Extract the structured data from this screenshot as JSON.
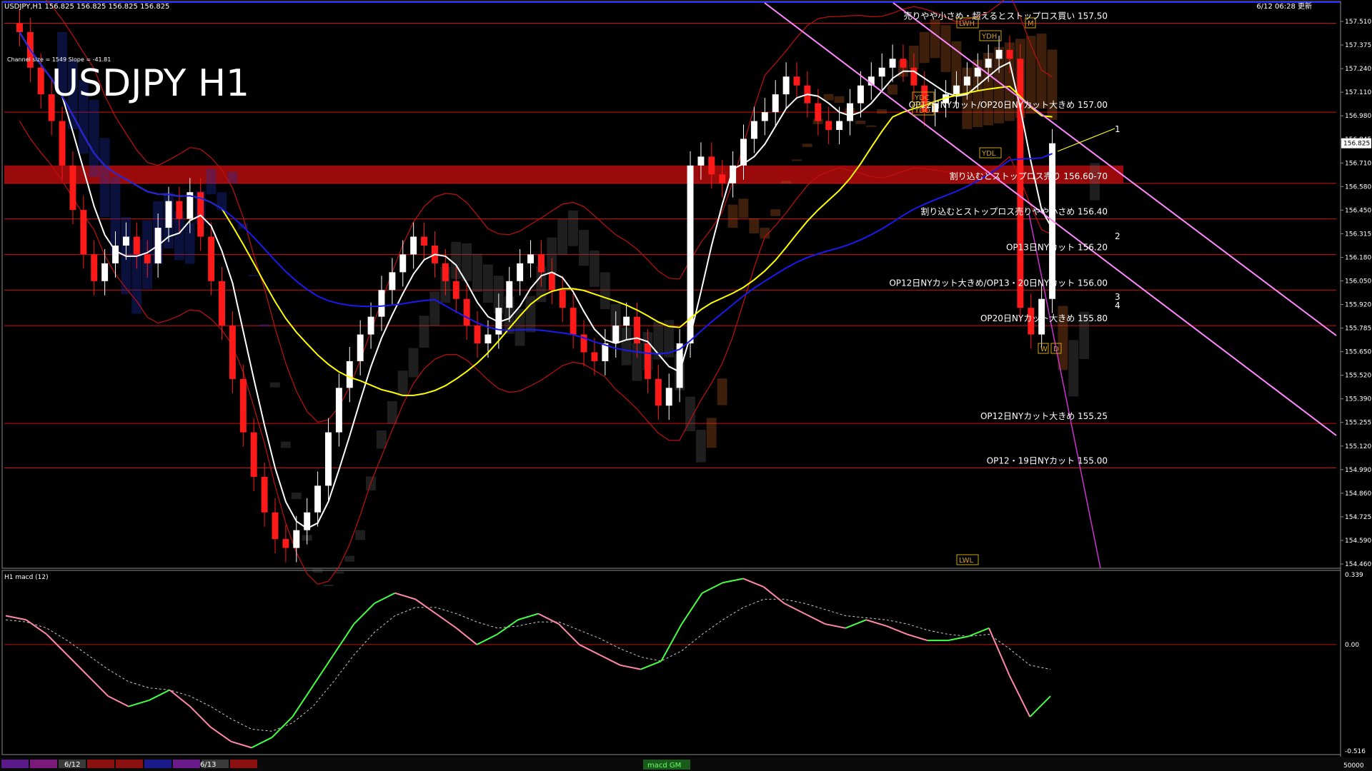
{
  "window": {
    "info_line": "USDJPY,H1  156.825 156.825 156.825 156.825",
    "datetime_label": "6/12 06:28 更新",
    "big_title": "USDJPY H1",
    "channel_info": "Channel size = 1549 Slope = -41.81",
    "subwindow_label": "H1  macd (12)"
  },
  "bottom_bar": {
    "date_labels": [
      "6/12",
      "6/13"
    ],
    "indicator_tag": "macd GM",
    "volume_label": "50000",
    "swatch_colors": [
      "#5a1a8a",
      "#7a1a7a",
      "#3a3a3a",
      "#8a1010",
      "#8a1010",
      "#1a1a8a",
      "#6a1a8a",
      "#3a3a3a",
      "#8a1010"
    ]
  },
  "colors": {
    "background": "#000000",
    "grid_text": "#ffffff",
    "bull_candle": "#ffffff",
    "bear_candle": "#ff1a1a",
    "level_line": "#d01010",
    "zone_fill": "#9a0a0a",
    "ma_fast": "#ffffff",
    "ma_mid": "#ffff00",
    "ma_slow": "#1a1aee",
    "channel_line": "#ff88ff",
    "macd_line_up": "#44ff44",
    "macd_line_down": "#ff88aa",
    "signal_line": "#cccccc"
  },
  "chart_data": [
    {
      "type": "candlestick",
      "title": "USDJPY H1",
      "symbol": "USDJPY",
      "timeframe": "H1",
      "current_price": 156.825,
      "ylim": [
        154.46,
        157.51
      ],
      "y_ticks": [
        "157.510",
        "157.375",
        "157.240",
        "157.110",
        "156.980",
        "156.845",
        "156.710",
        "156.580",
        "156.450",
        "156.315",
        "156.180",
        "156.050",
        "155.920",
        "155.785",
        "155.650",
        "155.520",
        "155.390",
        "155.255",
        "155.120",
        "154.990",
        "154.860",
        "154.725",
        "154.590",
        "154.460"
      ],
      "current_price_label": "156.825",
      "closes": [
        157.45,
        157.25,
        157.1,
        156.95,
        156.7,
        156.45,
        156.2,
        156.05,
        156.15,
        156.25,
        156.3,
        156.2,
        156.15,
        156.35,
        156.5,
        156.4,
        156.55,
        156.3,
        156.05,
        155.8,
        155.5,
        155.2,
        154.95,
        154.75,
        154.6,
        154.55,
        154.65,
        154.75,
        154.9,
        155.2,
        155.45,
        155.6,
        155.75,
        155.85,
        156.0,
        156.1,
        156.2,
        156.3,
        156.25,
        156.15,
        156.05,
        155.95,
        155.8,
        155.7,
        155.75,
        155.9,
        156.05,
        156.15,
        156.2,
        156.1,
        156.0,
        155.9,
        155.75,
        155.65,
        155.6,
        155.7,
        155.8,
        155.85,
        155.7,
        155.5,
        155.35,
        155.45,
        155.7,
        156.7,
        156.75,
        156.65,
        156.6,
        156.7,
        156.85,
        156.95,
        157.0,
        157.1,
        157.2,
        157.15,
        157.05,
        156.95,
        156.9,
        156.95,
        157.05,
        157.15,
        157.2,
        157.25,
        157.3,
        157.25,
        157.15,
        157.0,
        157.05,
        157.1,
        157.15,
        157.2,
        157.25,
        157.3,
        157.35,
        157.3,
        155.9,
        155.75,
        155.95,
        156.825
      ],
      "levels": [
        {
          "price": 157.5,
          "label": "売りやや小さめ・超えるとストップロス買い 157.50"
        },
        {
          "price": 157.0,
          "label": "OP12日NYカット/OP20日NYカット大きめ 157.00"
        },
        {
          "price": 156.6,
          "label": "割り込むとストップロス売り 156.60-70",
          "zone_top": 156.7
        },
        {
          "price": 156.4,
          "label": "割り込むとストップロス売りやや小さめ 156.40"
        },
        {
          "price": 156.2,
          "label": "OP13日NYカット 156.20"
        },
        {
          "price": 156.0,
          "label": "OP12日NYカット大きめ/OP13・20日NYカット 156.00"
        },
        {
          "price": 155.8,
          "label": "OP20日NYカット大きめ 155.80"
        },
        {
          "price": 155.25,
          "label": "OP12日NYカット大きめ 155.25"
        },
        {
          "price": 155.0,
          "label": "OP12・19日NYカット 155.00"
        }
      ],
      "markers": [
        "1",
        "2",
        "3",
        "4"
      ],
      "box_tags": [
        "LWH",
        "YDH",
        "YDC",
        "YDO",
        "YDL",
        "LWL",
        "M",
        "W",
        "D"
      ]
    },
    {
      "type": "line",
      "title": "H1  macd (12)",
      "ylim": [
        -0.516,
        0.339
      ],
      "y_ticks": [
        "0.339",
        "0.00",
        "-0.516"
      ],
      "macd": [
        0.14,
        0.12,
        0.05,
        -0.05,
        -0.15,
        -0.25,
        -0.3,
        -0.27,
        -0.22,
        -0.3,
        -0.4,
        -0.47,
        -0.5,
        -0.45,
        -0.35,
        -0.2,
        -0.05,
        0.1,
        0.2,
        0.25,
        0.22,
        0.15,
        0.08,
        0.0,
        0.05,
        0.12,
        0.15,
        0.1,
        0.0,
        -0.05,
        -0.1,
        -0.12,
        -0.08,
        0.1,
        0.25,
        0.3,
        0.32,
        0.28,
        0.2,
        0.15,
        0.1,
        0.08,
        0.12,
        0.09,
        0.05,
        0.02,
        0.02,
        0.04,
        0.08,
        -0.15,
        -0.35,
        -0.25
      ],
      "signal": [
        0.12,
        0.11,
        0.08,
        0.02,
        -0.05,
        -0.12,
        -0.18,
        -0.21,
        -0.22,
        -0.25,
        -0.3,
        -0.36,
        -0.41,
        -0.42,
        -0.38,
        -0.3,
        -0.18,
        -0.05,
        0.06,
        0.14,
        0.18,
        0.18,
        0.15,
        0.11,
        0.08,
        0.09,
        0.11,
        0.11,
        0.07,
        0.03,
        -0.02,
        -0.06,
        -0.08,
        -0.03,
        0.05,
        0.12,
        0.18,
        0.22,
        0.22,
        0.2,
        0.17,
        0.14,
        0.13,
        0.12,
        0.1,
        0.07,
        0.05,
        0.04,
        0.05,
        -0.02,
        -0.1,
        -0.12
      ]
    }
  ]
}
